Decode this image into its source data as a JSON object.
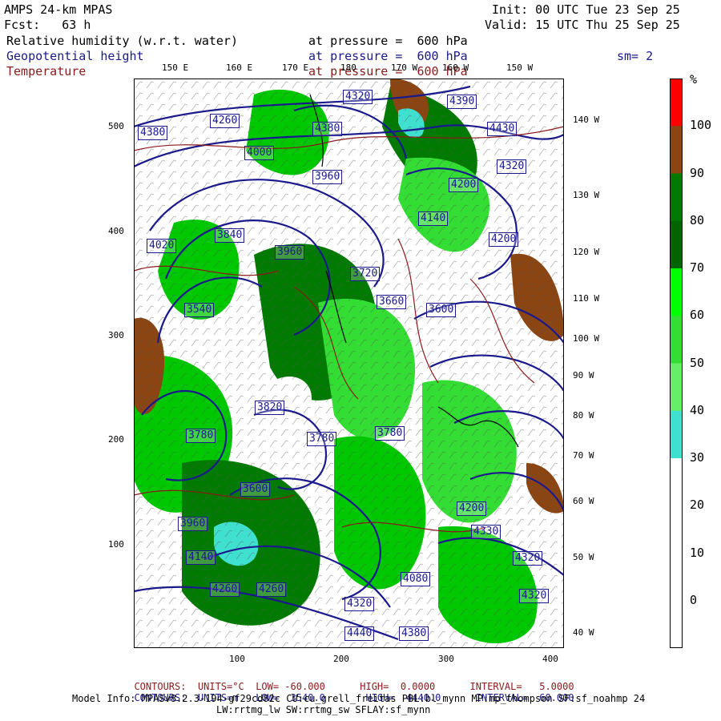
{
  "header": {
    "model": "AMPS 24-km MPAS",
    "fcst": "Fcst:   63 h",
    "init": "Init: 00 UTC Tue 23 Sep 25",
    "valid": "Valid: 15 UTC Thu 25 Sep 25",
    "fields": [
      {
        "name": "Relative humidity (w.r.t. water)",
        "level": "at pressure =  600 hPa",
        "color": "#000000"
      },
      {
        "name": "Geopotential height",
        "level": "at pressure =  600 hPa",
        "color": "#1a1a8c"
      },
      {
        "name": "Temperature",
        "level": "at pressure =  600 hPa",
        "color": "#8b1a1a"
      }
    ],
    "smooth": "sm= 2"
  },
  "axes": {
    "x_ticks": [
      "100",
      "200",
      "300",
      "400"
    ],
    "y_ticks": [
      "100",
      "200",
      "300",
      "400",
      "500"
    ],
    "top_lon": [
      "150 E",
      "160 E",
      "170 E",
      "180",
      "170 W",
      "160 W",
      "150 W"
    ],
    "right_lon": [
      "140 W",
      "130 W",
      "120 W",
      "110 W",
      "100 W",
      "90 W",
      "80 W",
      "70 W",
      "60 W",
      "50 W",
      "40 W"
    ]
  },
  "contour_labels": [
    "4380",
    "4260",
    "4320",
    "4390",
    "4430",
    "4380",
    "4000",
    "3960",
    "4200",
    "4140",
    "4020",
    "3840",
    "3960",
    "3720",
    "3660",
    "3600",
    "3540",
    "3780",
    "3820",
    "3780",
    "3780",
    "3600",
    "3960",
    "4140",
    "4260",
    "4320",
    "4080",
    "4320",
    "4200",
    "4440",
    "4380",
    "4260",
    "4320",
    "4200",
    "4330",
    "4320"
  ],
  "colorbar": {
    "unit": "%",
    "levels": [
      "100",
      "90",
      "80",
      "70",
      "60",
      "50",
      "40",
      "30",
      "20",
      "10",
      "0"
    ],
    "colors": [
      "#ff0000",
      "#8b4513",
      "#007a00",
      "#006400",
      "#00ff00",
      "#33dd33",
      "#66ee66",
      "#40e0d0",
      "#ffffff",
      "#ffffff",
      "#ffffff",
      "#ffffff"
    ]
  },
  "footer": {
    "line1": {
      "label": "CONTOURS:",
      "units": "UNITS=°C",
      "low": "LOW= -60.000",
      "high": "HIGH=  0.0000",
      "interval": "INTERVAL=   5.0000"
    },
    "line2": {
      "label": "CONTOURS:",
      "units": "UNITS=m",
      "low": "LOW=  3540.0",
      "high": "HIGH=  4440.0",
      "interval": "INTERVAL=  60.000"
    },
    "model_info": "Model Info: MPASv8.2.3-194-gf29cd82c CU:cu_grell_freitas PBL:bl_mynn MP:mp_thompson SF:sf_noahmp 24",
    "model_info2": "LW:rrtmg_lw SW:rrtmg_sw SFLAY:sf_mynn"
  }
}
